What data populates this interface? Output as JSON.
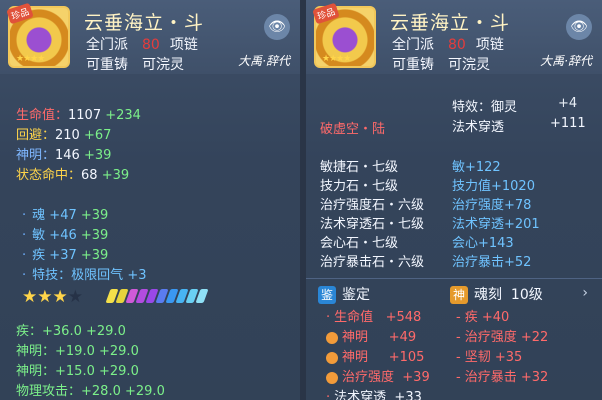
{
  "item": {
    "name": "云垂海立・斗",
    "sect": "全门派",
    "level": "80",
    "slot": "项链",
    "tags": [
      "可重铸",
      "可浣灵"
    ],
    "series": "大禹·辞代",
    "badge": "珍品"
  },
  "left": {
    "base_stats": [
      {
        "name": "生命值：",
        "base": "1107",
        "bonus": "+234"
      },
      {
        "name": "回避：",
        "base": "210",
        "bonus": "+67"
      },
      {
        "name": "神明：",
        "base": "146",
        "bonus": "+39"
      },
      {
        "name": "状态命中：",
        "base": "68",
        "bonus": "+39"
      }
    ],
    "attrs": [
      {
        "name": "魂",
        "base": "+47",
        "bonus": "+39"
      },
      {
        "name": "敏",
        "base": "+46",
        "bonus": "+39"
      },
      {
        "name": "疾",
        "base": "+37",
        "bonus": "+39"
      }
    ],
    "special": {
      "label": "特技：",
      "name": "极限回气",
      "value": "+3"
    },
    "star_rating": {
      "filled": 3,
      "total": 4
    },
    "gem_colors": [
      "#f4e04a",
      "#e7d33c",
      "#cf5ad8",
      "#b34ce0",
      "#9a48e8",
      "#5a7cf0",
      "#3a98f2",
      "#48b4f4",
      "#6ad0f4",
      "#8fe0f6"
    ],
    "extra_lines": [
      {
        "name": "疾：",
        "a": "+36.0",
        "b": "+29.0"
      },
      {
        "name": "神明：",
        "a": "+19.0",
        "b": "+29.0"
      },
      {
        "name": "神明：",
        "a": "+15.0",
        "b": "+29.0"
      },
      {
        "name": "物理攻击：",
        "a": "+28.0",
        "b": "+29.0"
      }
    ]
  },
  "right": {
    "special": {
      "label": "特效：",
      "name": "御灵",
      "value": "+4"
    },
    "pierce": {
      "name": "法术穿透",
      "value": "+111"
    },
    "title_line": "破虚空・陆",
    "stones": [
      {
        "name": "敏捷石・七级",
        "effect": "敏+122"
      },
      {
        "name": "技力石・七级",
        "effect": "技力值+1020"
      },
      {
        "name": "治疗强度石・六级",
        "effect": "治疗强度+78"
      },
      {
        "name": "法术穿透石・七级",
        "effect": "法术穿透+201"
      },
      {
        "name": "会心石・七级",
        "effect": "会心+143"
      },
      {
        "name": "治疗暴击石・六级",
        "effect": "治疗暴击+52"
      }
    ],
    "appraise": {
      "badge": "鉴",
      "label": "鉴定"
    },
    "soul": {
      "badge": "神",
      "label": "魂刻",
      "level": "10级"
    },
    "appraise_lines": [
      {
        "name": "生命值",
        "value": "+548",
        "type": "red"
      },
      {
        "name": "神明",
        "value": "+49",
        "type": "orange"
      },
      {
        "name": "神明",
        "value": "+105",
        "type": "orange"
      },
      {
        "name": "治疗强度",
        "value": "+39",
        "type": "orange"
      },
      {
        "name": "法术穿透",
        "value": "+33",
        "type": "red"
      }
    ],
    "soul_lines": [
      {
        "name": "疾",
        "value": "+40"
      },
      {
        "name": "治疗强度",
        "value": "+22"
      },
      {
        "name": "坚韧",
        "value": "+35"
      },
      {
        "name": "治疗暴击",
        "value": "+32"
      }
    ]
  }
}
